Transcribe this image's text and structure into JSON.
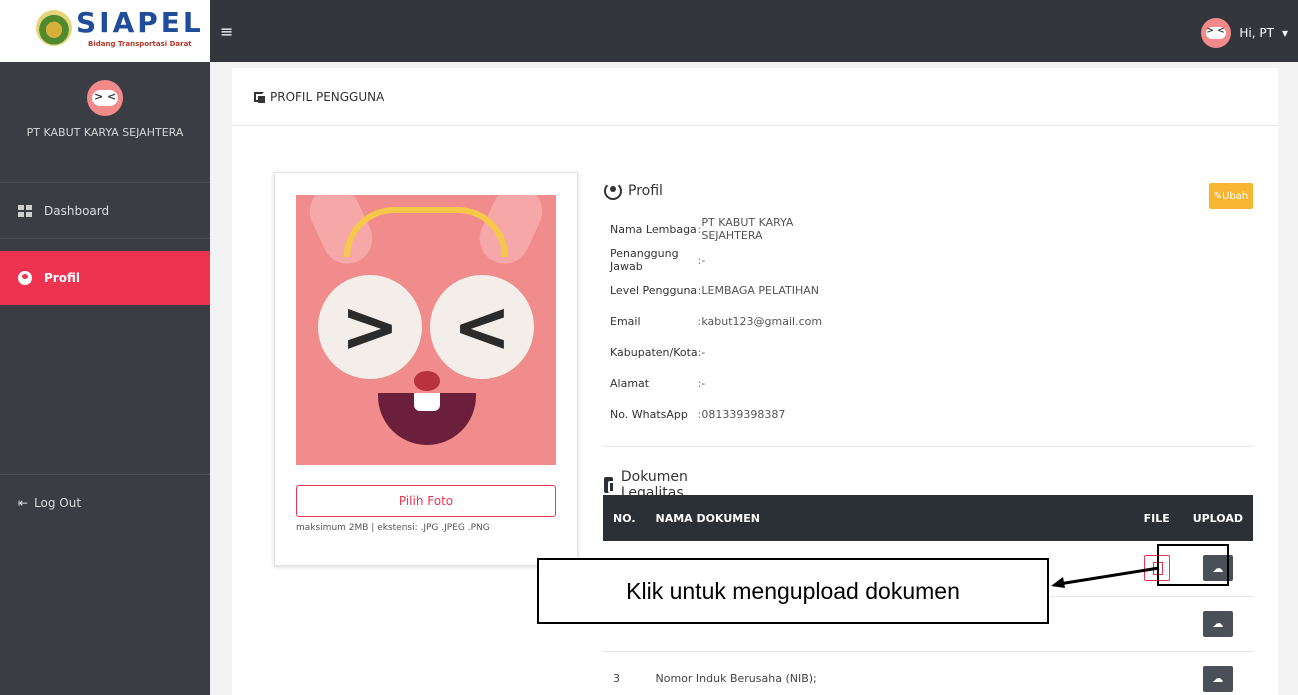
{
  "header": {
    "logo_text": "SIAPEL",
    "logo_subtitle": "Bidang Transportasi Darat",
    "menu_icon": "hamburger-icon",
    "user_greeting": "Hi, PT"
  },
  "sidebar": {
    "org_name": "PT KABUT KARYA SEJAHTERA",
    "items": [
      {
        "label": "Dashboard",
        "icon": "dashboard-icon",
        "active": false
      },
      {
        "label": "Profil",
        "icon": "user-icon",
        "active": true
      }
    ],
    "logout_label": "Log Out",
    "active_color": "#ee3350"
  },
  "page": {
    "title": "PROFIL PENGGUNA"
  },
  "photo_card": {
    "button_label": "Pilih Foto",
    "hint": "maksimum 2MB | ekstensi: .JPG .JPEG .PNG"
  },
  "profile": {
    "title": "Profil",
    "edit_label": "Ubah",
    "fields": [
      {
        "label": "Nama Lembaga",
        "value": "PT KABUT KARYA SEJAHTERA"
      },
      {
        "label": "Penanggung Jawab",
        "value": "-"
      },
      {
        "label": "Level Pengguna",
        "value": "LEMBAGA PELATIHAN"
      },
      {
        "label": "Email",
        "value": "kabut123@gmail.com"
      },
      {
        "label": "Kabupaten/Kota",
        "value": "-"
      },
      {
        "label": "Alamat",
        "value": "-"
      },
      {
        "label": "No. WhatsApp",
        "value": "081339398387"
      }
    ],
    "separator": ":"
  },
  "documents": {
    "title": "Dokumen Legalitas",
    "columns": {
      "no": "NO.",
      "name": "NAMA DOKUMEN",
      "file": "FILE",
      "upload": "UPLOAD"
    },
    "rows": [
      {
        "no": "",
        "name": ""
      },
      {
        "no": "",
        "name": ""
      },
      {
        "no": "3",
        "name": "Nomor Induk Berusaha (NIB);"
      }
    ]
  },
  "annotation": {
    "callout_text": "Klik untuk mengupload dokumen"
  }
}
